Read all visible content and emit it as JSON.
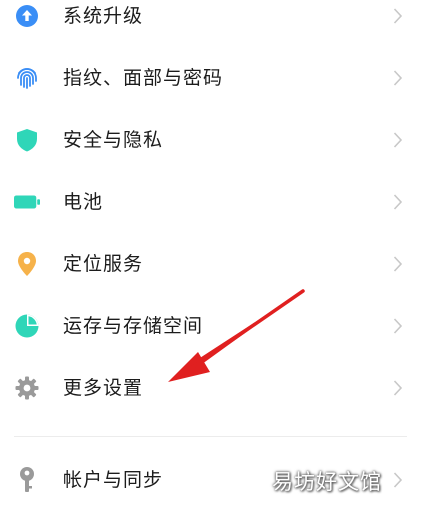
{
  "settings": {
    "items": [
      {
        "label": "系统升级",
        "icon": "upload-arrow-icon"
      },
      {
        "label": "指纹、面部与密码",
        "icon": "fingerprint-icon"
      },
      {
        "label": "安全与隐私",
        "icon": "shield-icon"
      },
      {
        "label": "电池",
        "icon": "battery-icon"
      },
      {
        "label": "定位服务",
        "icon": "location-pin-icon"
      },
      {
        "label": "运存与存储空间",
        "icon": "pie-chart-icon"
      },
      {
        "label": "更多设置",
        "icon": "gear-icon"
      },
      {
        "label": "帐户与同步",
        "icon": "key-icon"
      }
    ]
  },
  "watermark": "易坊好文馆",
  "colors": {
    "blue": "#3a8ef6",
    "teal": "#2fd6b8",
    "orange": "#f6b24a",
    "gray": "#9a9a9a",
    "arrow": "#e02020"
  }
}
